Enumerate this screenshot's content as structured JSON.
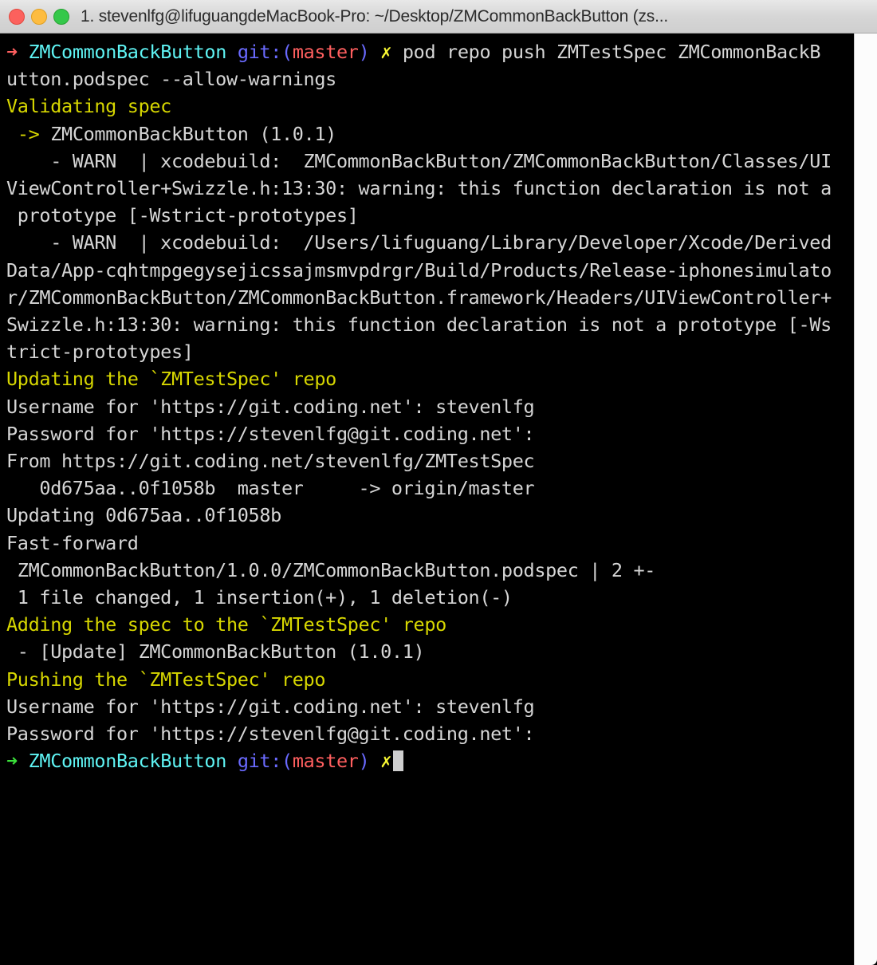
{
  "window": {
    "title": "1. stevenlfg@lifuguangdeMacBook-Pro: ~/Desktop/ZMCommonBackButton (zs...",
    "controls": {
      "close_label": "",
      "minimize_label": "",
      "zoom_label": ""
    }
  },
  "colors": {
    "background": "#000000",
    "foreground": "#d6d6d6",
    "yellow": "#d7d700",
    "cyan": "#5ff4f4",
    "blue": "#6a6aff",
    "red": "#ff5f5f",
    "green": "#3ae03a",
    "bright_yellow": "#f7f733",
    "titlebar": "#d6d6d6",
    "cursor": "#cfcfcf"
  },
  "prompt": {
    "arrow_first": "➜",
    "arrow_last": "➜",
    "repo": "ZMCommonBackButton",
    "git_prefix": "git:(",
    "branch": "master",
    "git_suffix": ")",
    "dirty_mark": "✗"
  },
  "terminal": {
    "command": "pod repo push ZMTestSpec ZMCommonBackB",
    "command_wrap": "utton.podspec --allow-warnings",
    "lines": [
      {
        "id": "blank-1",
        "text": ""
      },
      {
        "id": "validating-spec",
        "text": "Validating spec"
      },
      {
        "id": "spec-arrow",
        "text": "->"
      },
      {
        "id": "spec-name",
        "text": " ZMCommonBackButton (1.0.1)"
      },
      {
        "id": "warn-1-a",
        "text": "    - WARN  | xcodebuild:  ZMCommonBackButton/ZMCommonBackButton/Classes/UI"
      },
      {
        "id": "warn-1-b",
        "text": "ViewController+Swizzle.h:13:30: warning: this function declaration is not a"
      },
      {
        "id": "warn-1-c",
        "text": " prototype [-Wstrict-prototypes]"
      },
      {
        "id": "warn-2-a",
        "text": "    - WARN  | xcodebuild:  /Users/lifuguang/Library/Developer/Xcode/Derived"
      },
      {
        "id": "warn-2-b",
        "text": "Data/App-cqhtmpgegysejicssajmsmvpdrgr/Build/Products/Release-iphonesimulato"
      },
      {
        "id": "warn-2-c",
        "text": "r/ZMCommonBackButton/ZMCommonBackButton.framework/Headers/UIViewController+"
      },
      {
        "id": "warn-2-d",
        "text": "Swizzle.h:13:30: warning: this function declaration is not a prototype [-Ws"
      },
      {
        "id": "warn-2-e",
        "text": "trict-prototypes]"
      },
      {
        "id": "blank-2",
        "text": ""
      },
      {
        "id": "updating-repo",
        "text": "Updating the `ZMTestSpec' repo"
      },
      {
        "id": "blank-3",
        "text": ""
      },
      {
        "id": "username-1",
        "text": "Username for 'https://git.coding.net': stevenlfg"
      },
      {
        "id": "password-1",
        "text": "Password for 'https://stevenlfg@git.coding.net':"
      },
      {
        "id": "from-remote",
        "text": "From https://git.coding.net/stevenlfg/ZMTestSpec"
      },
      {
        "id": "ref-update",
        "text": "   0d675aa..0f1058b  master     -> origin/master"
      },
      {
        "id": "updating-hash",
        "text": "Updating 0d675aa..0f1058b"
      },
      {
        "id": "fast-forward",
        "text": "Fast-forward"
      },
      {
        "id": "diff-file",
        "text": " ZMCommonBackButton/1.0.0/ZMCommonBackButton.podspec | 2 +-"
      },
      {
        "id": "diff-stat",
        "text": " 1 file changed, 1 insertion(+), 1 deletion(-)"
      },
      {
        "id": "blank-4",
        "text": ""
      },
      {
        "id": "adding-spec",
        "text": "Adding the spec to the `ZMTestSpec' repo"
      },
      {
        "id": "blank-5",
        "text": ""
      },
      {
        "id": "update-entry",
        "text": " - [Update] ZMCommonBackButton (1.0.1)"
      },
      {
        "id": "blank-6",
        "text": ""
      },
      {
        "id": "pushing-repo",
        "text": "Pushing the `ZMTestSpec' repo"
      },
      {
        "id": "blank-7",
        "text": ""
      },
      {
        "id": "username-2",
        "text": "Username for 'https://git.coding.net': stevenlfg"
      },
      {
        "id": "password-2",
        "text": "Password for 'https://stevenlfg@git.coding.net':"
      }
    ]
  }
}
